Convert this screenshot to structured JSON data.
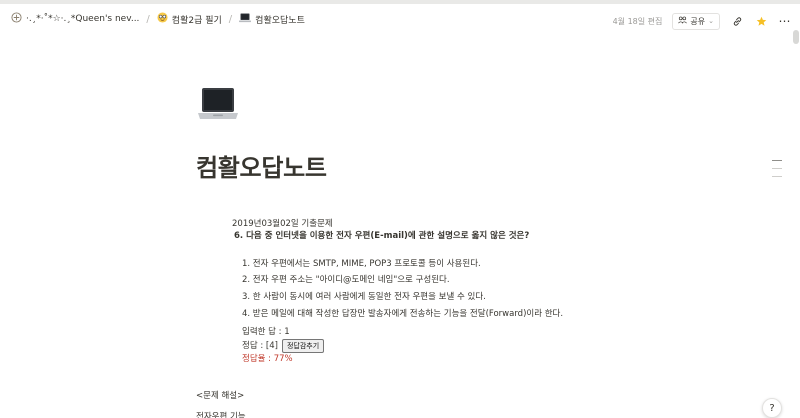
{
  "breadcrumb": {
    "items": [
      {
        "icon": "sparkle-icon",
        "label": "·.¸*·˚*☆·.¸*Queen's nev..."
      },
      {
        "icon": "nerd-face-icon",
        "label": "컴활2급 필기"
      },
      {
        "icon": "laptop-icon",
        "label": "컴활오답노트"
      }
    ],
    "separator": "/"
  },
  "header": {
    "edited": "4월 18일 편집",
    "share_label": "공유",
    "colors": {
      "star": "#f6c026"
    }
  },
  "page": {
    "icon": "laptop-icon",
    "title": "컴활오답노트"
  },
  "quiz": {
    "date": "2019년03월02일 기출문제",
    "question": "6. 다음 중 인터넷을 이용한 전자 우편(E-mail)에 관한 설명으로 옳지 않은 것은?",
    "choices": [
      "1. 전자 우편에서는 SMTP, MIME, POP3 프로토콜 등이 사용된다.",
      "2. 전자 우편 주소는 \"아이디@도메인 네임\"으로 구성된다.",
      "3. 한 사람이 동시에 여러 사람에게 동일한 전자 우편을 보낼 수 있다.",
      "4. 받은 메일에 대해 작성한 답장만 발송자에게 전송하는 기능을 전달(Forward)이라 한다."
    ],
    "entered_answer": "입력한 답 : 1",
    "correct_label": "정답 : [4]",
    "show_answer_button": "정답감추기",
    "correct_rate": "정답율 : 77%",
    "colors": {
      "rate": "#c0392b"
    }
  },
  "explanation": {
    "heading": "<문제 해설>",
    "next_line": "전자우편 기능"
  },
  "help": {
    "label": "?"
  }
}
